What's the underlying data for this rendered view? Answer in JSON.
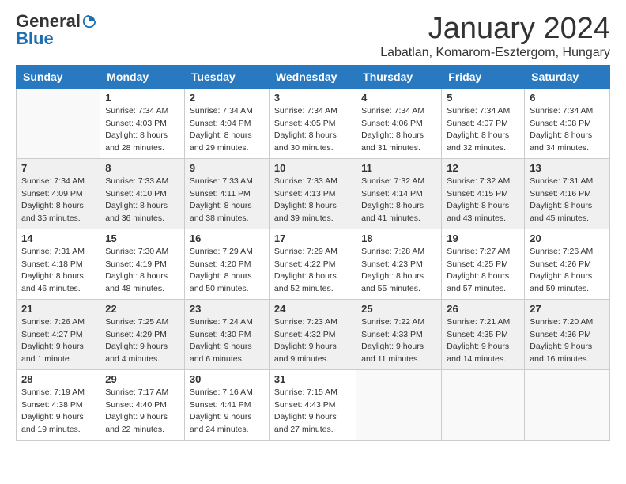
{
  "logo": {
    "general": "General",
    "blue": "Blue"
  },
  "title": {
    "month": "January 2024",
    "location": "Labatlan, Komarom-Esztergom, Hungary"
  },
  "headers": [
    "Sunday",
    "Monday",
    "Tuesday",
    "Wednesday",
    "Thursday",
    "Friday",
    "Saturday"
  ],
  "weeks": [
    [
      {
        "day": "",
        "info": ""
      },
      {
        "day": "1",
        "info": "Sunrise: 7:34 AM\nSunset: 4:03 PM\nDaylight: 8 hours\nand 28 minutes."
      },
      {
        "day": "2",
        "info": "Sunrise: 7:34 AM\nSunset: 4:04 PM\nDaylight: 8 hours\nand 29 minutes."
      },
      {
        "day": "3",
        "info": "Sunrise: 7:34 AM\nSunset: 4:05 PM\nDaylight: 8 hours\nand 30 minutes."
      },
      {
        "day": "4",
        "info": "Sunrise: 7:34 AM\nSunset: 4:06 PM\nDaylight: 8 hours\nand 31 minutes."
      },
      {
        "day": "5",
        "info": "Sunrise: 7:34 AM\nSunset: 4:07 PM\nDaylight: 8 hours\nand 32 minutes."
      },
      {
        "day": "6",
        "info": "Sunrise: 7:34 AM\nSunset: 4:08 PM\nDaylight: 8 hours\nand 34 minutes."
      }
    ],
    [
      {
        "day": "7",
        "info": "Sunrise: 7:34 AM\nSunset: 4:09 PM\nDaylight: 8 hours\nand 35 minutes."
      },
      {
        "day": "8",
        "info": "Sunrise: 7:33 AM\nSunset: 4:10 PM\nDaylight: 8 hours\nand 36 minutes."
      },
      {
        "day": "9",
        "info": "Sunrise: 7:33 AM\nSunset: 4:11 PM\nDaylight: 8 hours\nand 38 minutes."
      },
      {
        "day": "10",
        "info": "Sunrise: 7:33 AM\nSunset: 4:13 PM\nDaylight: 8 hours\nand 39 minutes."
      },
      {
        "day": "11",
        "info": "Sunrise: 7:32 AM\nSunset: 4:14 PM\nDaylight: 8 hours\nand 41 minutes."
      },
      {
        "day": "12",
        "info": "Sunrise: 7:32 AM\nSunset: 4:15 PM\nDaylight: 8 hours\nand 43 minutes."
      },
      {
        "day": "13",
        "info": "Sunrise: 7:31 AM\nSunset: 4:16 PM\nDaylight: 8 hours\nand 45 minutes."
      }
    ],
    [
      {
        "day": "14",
        "info": "Sunrise: 7:31 AM\nSunset: 4:18 PM\nDaylight: 8 hours\nand 46 minutes."
      },
      {
        "day": "15",
        "info": "Sunrise: 7:30 AM\nSunset: 4:19 PM\nDaylight: 8 hours\nand 48 minutes."
      },
      {
        "day": "16",
        "info": "Sunrise: 7:29 AM\nSunset: 4:20 PM\nDaylight: 8 hours\nand 50 minutes."
      },
      {
        "day": "17",
        "info": "Sunrise: 7:29 AM\nSunset: 4:22 PM\nDaylight: 8 hours\nand 52 minutes."
      },
      {
        "day": "18",
        "info": "Sunrise: 7:28 AM\nSunset: 4:23 PM\nDaylight: 8 hours\nand 55 minutes."
      },
      {
        "day": "19",
        "info": "Sunrise: 7:27 AM\nSunset: 4:25 PM\nDaylight: 8 hours\nand 57 minutes."
      },
      {
        "day": "20",
        "info": "Sunrise: 7:26 AM\nSunset: 4:26 PM\nDaylight: 8 hours\nand 59 minutes."
      }
    ],
    [
      {
        "day": "21",
        "info": "Sunrise: 7:26 AM\nSunset: 4:27 PM\nDaylight: 9 hours\nand 1 minute."
      },
      {
        "day": "22",
        "info": "Sunrise: 7:25 AM\nSunset: 4:29 PM\nDaylight: 9 hours\nand 4 minutes."
      },
      {
        "day": "23",
        "info": "Sunrise: 7:24 AM\nSunset: 4:30 PM\nDaylight: 9 hours\nand 6 minutes."
      },
      {
        "day": "24",
        "info": "Sunrise: 7:23 AM\nSunset: 4:32 PM\nDaylight: 9 hours\nand 9 minutes."
      },
      {
        "day": "25",
        "info": "Sunrise: 7:22 AM\nSunset: 4:33 PM\nDaylight: 9 hours\nand 11 minutes."
      },
      {
        "day": "26",
        "info": "Sunrise: 7:21 AM\nSunset: 4:35 PM\nDaylight: 9 hours\nand 14 minutes."
      },
      {
        "day": "27",
        "info": "Sunrise: 7:20 AM\nSunset: 4:36 PM\nDaylight: 9 hours\nand 16 minutes."
      }
    ],
    [
      {
        "day": "28",
        "info": "Sunrise: 7:19 AM\nSunset: 4:38 PM\nDaylight: 9 hours\nand 19 minutes."
      },
      {
        "day": "29",
        "info": "Sunrise: 7:17 AM\nSunset: 4:40 PM\nDaylight: 9 hours\nand 22 minutes."
      },
      {
        "day": "30",
        "info": "Sunrise: 7:16 AM\nSunset: 4:41 PM\nDaylight: 9 hours\nand 24 minutes."
      },
      {
        "day": "31",
        "info": "Sunrise: 7:15 AM\nSunset: 4:43 PM\nDaylight: 9 hours\nand 27 minutes."
      },
      {
        "day": "",
        "info": ""
      },
      {
        "day": "",
        "info": ""
      },
      {
        "day": "",
        "info": ""
      }
    ]
  ]
}
